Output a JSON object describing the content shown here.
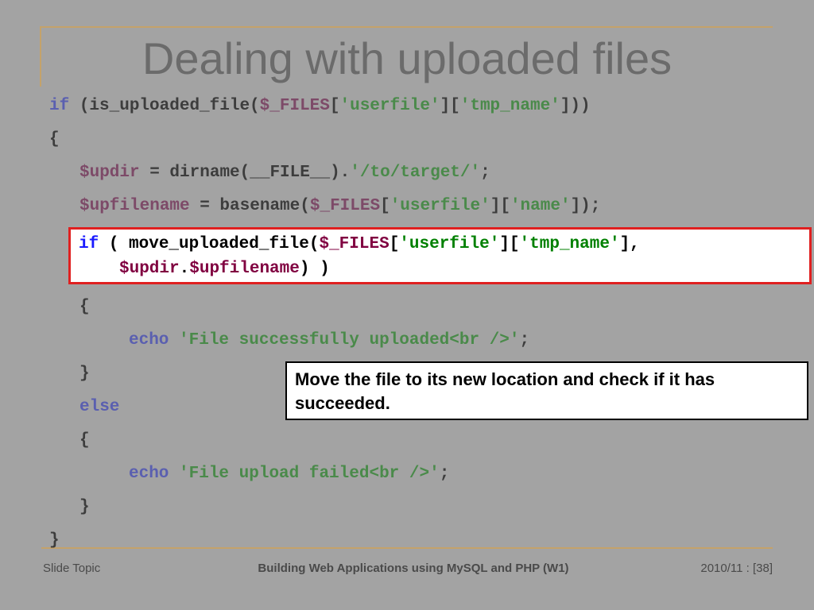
{
  "slide": {
    "title": "Dealing with uploaded files"
  },
  "code": {
    "l1_kw": "if",
    "l1_a": " (is_uploaded_file(",
    "l1_var": "$_FILES",
    "l1_b": "[",
    "l1_s1": "'userfile'",
    "l1_c": "][",
    "l1_s2": "'tmp_name'",
    "l1_d": "]))",
    "l2": "{",
    "l3_var": "$updir",
    "l3_a": " = dirname(__FILE__).",
    "l3_s": "'/to/target/'",
    "l3_b": ";",
    "l4_var": "$upfilename",
    "l4_a": " = basename(",
    "l4_var2": "$_FILES",
    "l4_b": "[",
    "l4_s1": "'userfile'",
    "l4_c": "][",
    "l4_s2": "'name'",
    "l4_d": "]);",
    "l5_kw": "if",
    "l5_a": " ( move_uploaded_file(",
    "l5_var": "$_FILES",
    "l5_b": "[",
    "l5_s1": "'userfile'",
    "l5_c": "][",
    "l5_s2": "'tmp_name'",
    "l5_d": "],",
    "l6_var": "$updir",
    "l6_dot": ".",
    "l6_var2": "$upfilename",
    "l6_a": ") )",
    "l7": "{",
    "l8_kw": "echo",
    "l8_s": " 'File successfully uploaded<br />'",
    "l8_a": ";",
    "l9": "}",
    "l10_kw": "else",
    "l11": "{",
    "l12_kw": "echo",
    "l12_s": " 'File upload failed<br />'",
    "l12_a": ";",
    "l13": "}",
    "l14": "}"
  },
  "callout": {
    "text": "Move the file to its new location and check if it has succeeded."
  },
  "footer": {
    "left": "Slide Topic",
    "center": "Building Web Applications using MySQL and PHP (W1)",
    "right": "2010/11 : [38]"
  },
  "colors": {
    "background": "#a3a3a3",
    "highlight_border": "#e02020",
    "accent_line": "#c4a26a"
  }
}
